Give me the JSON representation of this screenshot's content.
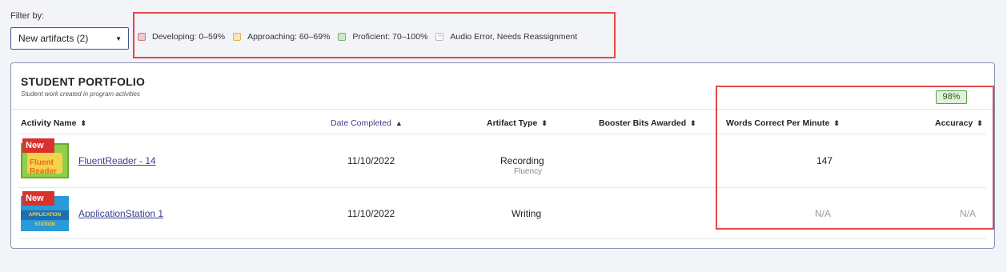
{
  "filter": {
    "label": "Filter by:",
    "selected": "New artifacts (2)"
  },
  "legend": [
    {
      "label": "Developing: 0–59%",
      "color": "#f4c7c7"
    },
    {
      "label": "Approaching: 60–69%",
      "color": "#fbe7b3"
    },
    {
      "label": "Proficient: 70–100%",
      "color": "#cfe9c8"
    },
    {
      "label": "Audio Error, Needs Reassignment",
      "symbol": "--"
    }
  ],
  "portfolio": {
    "title": "STUDENT PORTFOLIO",
    "subtitle": "Student work created in program activities",
    "columns": {
      "activity": "Activity Name",
      "date": "Date Completed",
      "type": "Artifact Type",
      "booster": "Booster Bits Awarded",
      "wcpm": "Words Correct Per Minute",
      "accuracy": "Accuracy"
    },
    "rows": [
      {
        "badge": "New",
        "thumb_text": "Fluent Reader",
        "activity": "FluentReader - 14",
        "date": "11/10/2022",
        "type": "Recording",
        "subtype": "Fluency",
        "booster": "",
        "wcpm": "147",
        "accuracy": "98%"
      },
      {
        "badge": "New",
        "thumb_text": "APPLICATION STATION",
        "activity": "ApplicationStation 1",
        "date": "11/10/2022",
        "type": "Writing",
        "subtype": "",
        "booster": "",
        "wcpm": "N/A",
        "accuracy": "N/A"
      }
    ]
  },
  "colors": {
    "accent": "#3b3f8c",
    "new_badge": "#d8322f",
    "highlight_box": "#e04848",
    "proficient_bg": "#dff2da"
  }
}
